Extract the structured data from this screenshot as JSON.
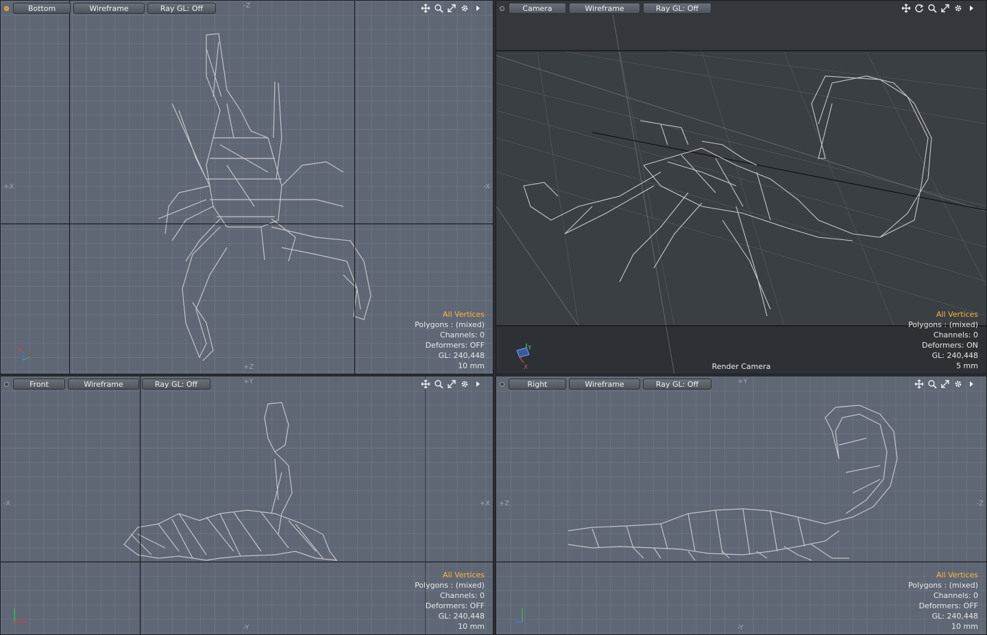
{
  "viewports": [
    {
      "id": "bottom",
      "view_label": "Bottom",
      "shading_label": "Wireframe",
      "raygl_label": "Ray GL: Off",
      "axis_top": "-Z",
      "axis_bottom": "+Z",
      "axis_left": "+X",
      "axis_right": "-X",
      "info": {
        "selection": "All Vertices",
        "polygons": "Polygons : (mixed)",
        "channels": "Channels: 0",
        "deformers": "Deformers: OFF",
        "gl": "GL: 240,448",
        "scale": "10 mm"
      }
    },
    {
      "id": "camera",
      "view_label": "Camera",
      "shading_label": "Wireframe",
      "raygl_label": "Ray GL: Off",
      "camera_name": "Render Camera",
      "info": {
        "selection": "All Vertices",
        "polygons": "Polygons : (mixed)",
        "channels": "Channels: 0",
        "deformers": "Deformers: ON",
        "gl": "GL: 240,448",
        "scale": "5 mm"
      }
    },
    {
      "id": "front",
      "view_label": "Front",
      "shading_label": "Wireframe",
      "raygl_label": "Ray GL: Off",
      "axis_top": "+Y",
      "axis_bottom": "-Y",
      "axis_left": "-X",
      "axis_right": "+X",
      "info": {
        "selection": "All Vertices",
        "polygons": "Polygons : (mixed)",
        "channels": "Channels: 0",
        "deformers": "Deformers: OFF",
        "gl": "GL: 240,448",
        "scale": "10 mm"
      }
    },
    {
      "id": "right",
      "view_label": "Right",
      "shading_label": "Wireframe",
      "raygl_label": "Ray GL: Off",
      "axis_top": "+Y",
      "axis_bottom": "-Y",
      "axis_left": "+Z",
      "axis_right": "-Z",
      "info": {
        "selection": "All Vertices",
        "polygons": "Polygons : (mixed)",
        "channels": "Channels: 0",
        "deformers": "Deformers: OFF",
        "gl": "GL: 240,448",
        "scale": "10 mm"
      }
    }
  ],
  "gizmo_labels": {
    "x": "X",
    "y": "Y",
    "z": "Z"
  },
  "icons": [
    "move-icon",
    "zoom-icon",
    "maximize-icon",
    "gear-icon",
    "expand-arrow-icon",
    "rotate-icon"
  ],
  "colors": {
    "viewport_bg": "#5f6775",
    "camera_bg": "#3a3f44",
    "selection_text": "#ffb43a",
    "mesh": "#d2d2d2"
  }
}
